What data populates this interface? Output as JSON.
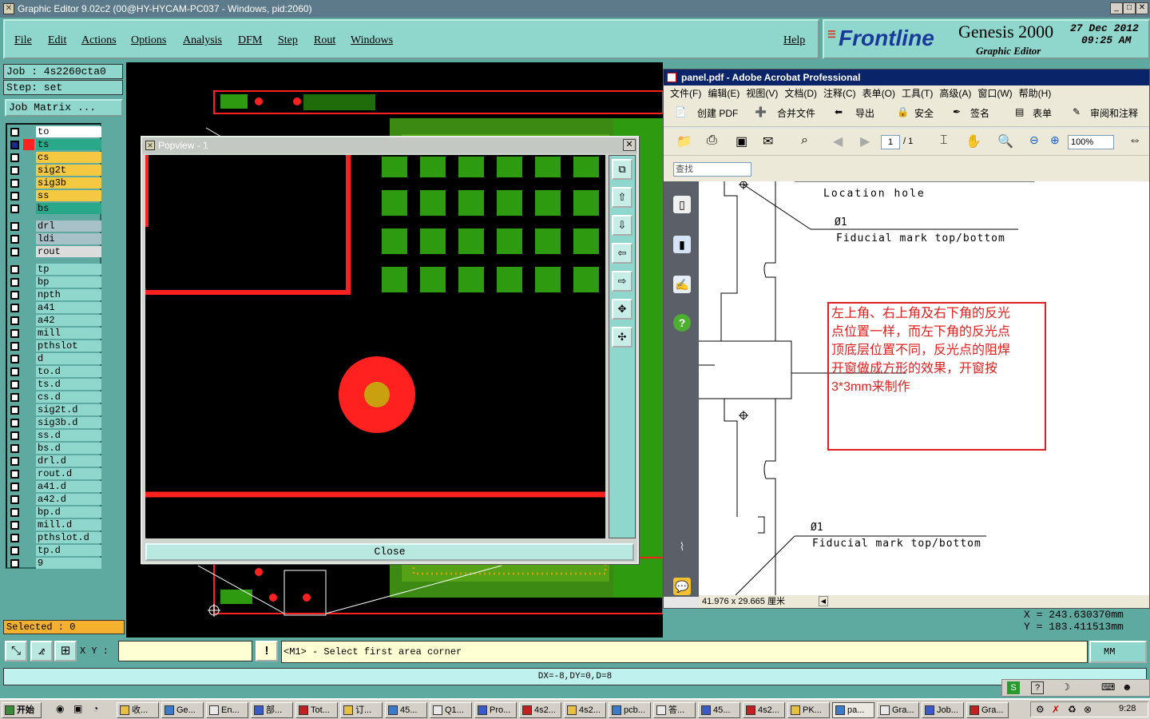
{
  "window": {
    "title": "Graphic Editor 9.02c2 (00@HY-HYCAM-PC037 - Windows, pid:2060)"
  },
  "menu": {
    "items": [
      "File",
      "Edit",
      "Actions",
      "Options",
      "Analysis",
      "DFM",
      "Step",
      "Rout",
      "Windows"
    ],
    "help": "Help"
  },
  "brand": {
    "logo": "Frontline",
    "product": "Genesis 2000",
    "module": "Graphic Editor",
    "date": "27 Dec 2012",
    "time": "09:25 AM"
  },
  "job": {
    "job_label": "Job : 4s2260cta0",
    "step_label": "Step: set",
    "matrix_button": "Job Matrix ..."
  },
  "layers": [
    {
      "name": "to",
      "color": "#ffffff"
    },
    {
      "name": "ts",
      "color": "#2aa88a"
    },
    {
      "name": "cs",
      "color": "#f5c842"
    },
    {
      "name": "sig2t",
      "color": "#f5c842"
    },
    {
      "name": "sig3b",
      "color": "#f5c842"
    },
    {
      "name": "ss",
      "color": "#f5c842"
    },
    {
      "name": "bs",
      "color": "#2aa88a"
    },
    {
      "name": "drl",
      "color": "#a8c0c8"
    },
    {
      "name": "ldi",
      "color": "#a8c0c8"
    },
    {
      "name": "rout",
      "color": "#dcdcdc"
    },
    {
      "name": "tp",
      "color": "#8fd6cc"
    },
    {
      "name": "bp",
      "color": "#8fd6cc"
    },
    {
      "name": "npth",
      "color": "#8fd6cc"
    },
    {
      "name": "a41",
      "color": "#8fd6cc"
    },
    {
      "name": "a42",
      "color": "#8fd6cc"
    },
    {
      "name": "mill",
      "color": "#8fd6cc"
    },
    {
      "name": "pthslot",
      "color": "#8fd6cc"
    },
    {
      "name": "d",
      "color": "#8fd6cc"
    },
    {
      "name": "to.d",
      "color": "#8fd6cc"
    },
    {
      "name": "ts.d",
      "color": "#8fd6cc"
    },
    {
      "name": "cs.d",
      "color": "#8fd6cc"
    },
    {
      "name": "sig2t.d",
      "color": "#8fd6cc"
    },
    {
      "name": "sig3b.d",
      "color": "#8fd6cc"
    },
    {
      "name": "ss.d",
      "color": "#8fd6cc"
    },
    {
      "name": "bs.d",
      "color": "#8fd6cc"
    },
    {
      "name": "drl.d",
      "color": "#8fd6cc"
    },
    {
      "name": "rout.d",
      "color": "#8fd6cc"
    },
    {
      "name": "a41.d",
      "color": "#8fd6cc"
    },
    {
      "name": "a42.d",
      "color": "#8fd6cc"
    },
    {
      "name": "bp.d",
      "color": "#8fd6cc"
    },
    {
      "name": "mill.d",
      "color": "#8fd6cc"
    },
    {
      "name": "pthslot.d",
      "color": "#8fd6cc"
    },
    {
      "name": "tp.d",
      "color": "#8fd6cc"
    },
    {
      "name": "9",
      "color": "#8fd6cc"
    }
  ],
  "selected": "Selected : 0",
  "popview": {
    "title": "Popview - 1",
    "close_label": "Close"
  },
  "acrobat": {
    "title": "panel.pdf - Adobe Acrobat Professional",
    "menu": [
      "文件(F)",
      "编辑(E)",
      "视图(V)",
      "文档(D)",
      "注释(C)",
      "表单(O)",
      "工具(T)",
      "高级(A)",
      "窗口(W)",
      "帮助(H)"
    ],
    "toolbar1": [
      "创建 PDF",
      "合并文件",
      "导出",
      "安全",
      "签名",
      "表单",
      "审阅和注释"
    ],
    "page_current": "1",
    "page_total": "/ 1",
    "zoom": "100%",
    "find_placeholder": "查找",
    "page_size": "41.976 x 29.665 厘米",
    "doc_labels": [
      "Location hole",
      "Ø1",
      "Fiducial mark top/bottom",
      "Ø1",
      "Fiducial mark top/bottom"
    ],
    "note_lines": [
      "左上角、右上角及右下角的反光",
      "点位置一样，而左下角的反光点",
      "顶底层位置不同，反光点的阻焊",
      "开窗做成方形的效果，开窗按",
      "3*3mm来制作"
    ]
  },
  "coords": {
    "x": "X = 243.630370mm",
    "y": "Y = 183.411513mm"
  },
  "command": {
    "xy_label": "X Y :",
    "xy_value": "",
    "prompt": "<M1> - Select first area corner",
    "units": "MM"
  },
  "delta": "DX=-8,DY=0,D=8",
  "taskbar": {
    "start": "开始",
    "tasks": [
      "收...",
      "Ge...",
      "En...",
      "部...",
      "Tot...",
      "订...",
      "45...",
      "Q1...",
      "Pro...",
      "4s2...",
      "4s2...",
      "pcb...",
      "答...",
      "45...",
      "4s2...",
      "PK...",
      "pa...",
      "Gra...",
      "Job...",
      "Gra..."
    ],
    "clock": "9:28"
  },
  "colors": {
    "teal": "#8fd6cc",
    "pad_green": "#2e9a10",
    "trace_red": "#ff2020",
    "gold": "#c8a010"
  }
}
